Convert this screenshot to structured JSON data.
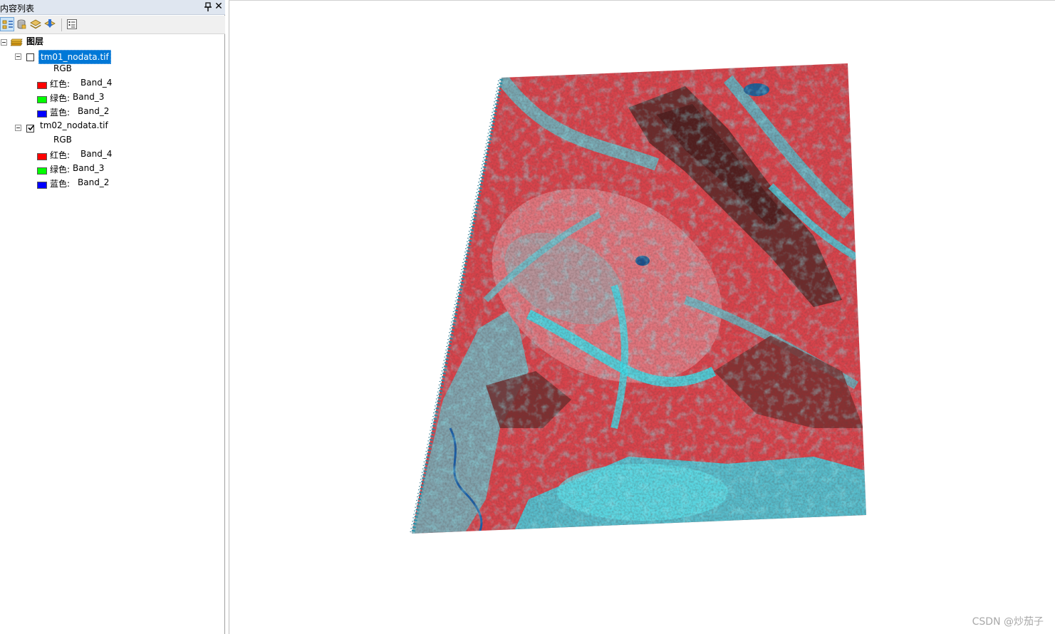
{
  "panel": {
    "title": "内容列表",
    "pin_icon": "pin-icon",
    "close_icon": "close-icon",
    "close_glyph": "✕"
  },
  "toolbar": {
    "buttons": [
      "list-by-drawing-order-icon",
      "list-by-source-icon",
      "list-by-visibility-icon",
      "list-by-selection-icon",
      "options-icon"
    ]
  },
  "tree": {
    "root_label": "图层",
    "layers": [
      {
        "name": "tm01_nodata.tif",
        "checked": false,
        "selected": true,
        "renderer": "RGB",
        "bands": [
          {
            "channel": "红色:",
            "band": "Band_4",
            "color": "#ff0000"
          },
          {
            "channel": "绿色:",
            "band": "Band_3",
            "color": "#00ff00"
          },
          {
            "channel": "蓝色:",
            "band": "Band_2",
            "color": "#0000ff"
          }
        ]
      },
      {
        "name": "tm02_nodata.tif",
        "checked": true,
        "selected": false,
        "renderer": "RGB",
        "bands": [
          {
            "channel": "红色:",
            "band": "Band_4",
            "color": "#ff0000"
          },
          {
            "channel": "绿色:",
            "band": "Band_3",
            "color": "#00ff00"
          },
          {
            "channel": "蓝色:",
            "band": "Band_2",
            "color": "#0000ff"
          }
        ]
      }
    ]
  },
  "map": {
    "raster_colors": {
      "vegetation": "#e2444c",
      "dark_relief": "#6b2b2b",
      "urban_water": "#3fd0e0",
      "bare": "#8a9aa8"
    }
  },
  "watermark": "CSDN @炒茄子"
}
